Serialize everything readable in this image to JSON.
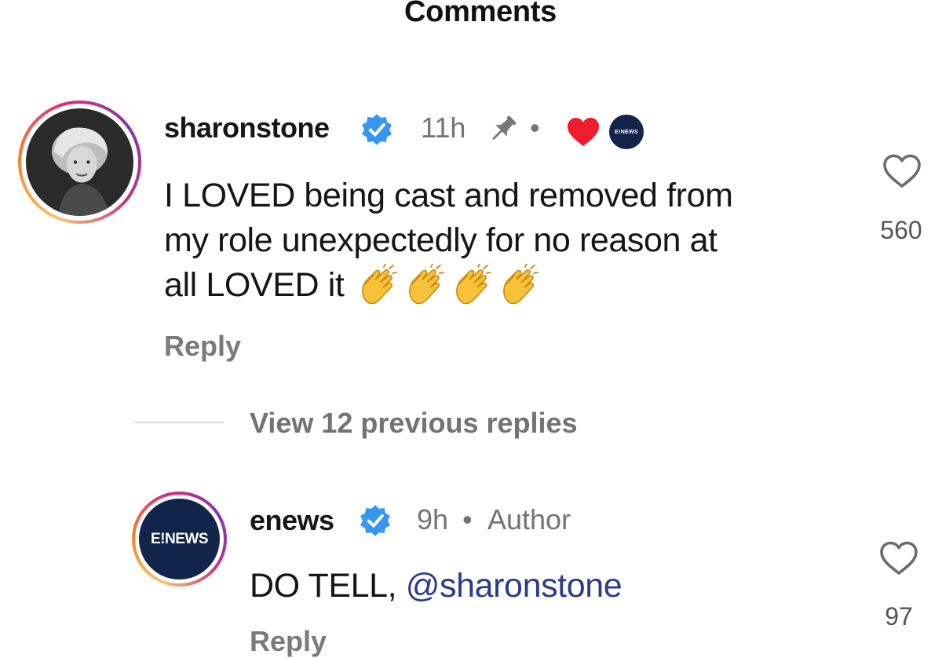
{
  "header": {
    "title": "Comments"
  },
  "comments": [
    {
      "username": "sharonstone",
      "time": "11h",
      "text_line1": "I LOVED being cast and removed from",
      "text_line2": "my role unexpectedly for no reason at",
      "text_line3": "all LOVED it",
      "emojis": [
        "clapping-hands",
        "clapping-hands",
        "clapping-hands",
        "clapping-hands"
      ],
      "reply_label": "Reply",
      "like_count": "560",
      "liked_by_author_badge": "E!NEWS"
    },
    {
      "username": "enews",
      "time": "9h",
      "separator": "•",
      "author_label": "Author",
      "text_prefix": "DO TELL, ",
      "mention": "@sharonstone",
      "reply_label": "Reply",
      "like_count": "97",
      "avatar_label": "E!NEWS"
    }
  ],
  "thread": {
    "view_replies_label": "View 12 previous replies"
  },
  "colors": {
    "verified": "#3797f0",
    "heart": "#ed1c2e",
    "mention": "#2b3a8c",
    "muted": "#737373"
  }
}
